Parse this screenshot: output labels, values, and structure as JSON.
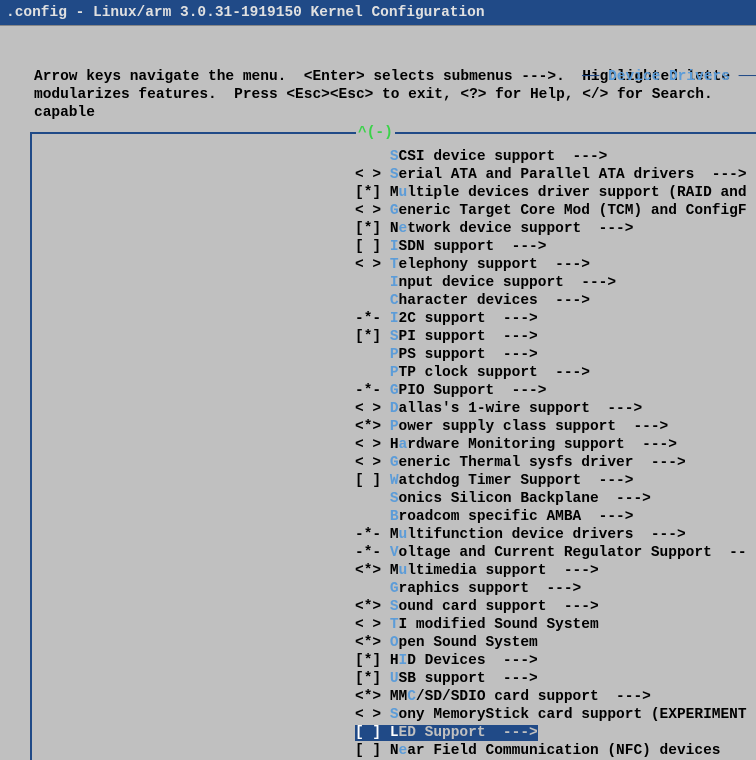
{
  "title": ".config - Linux/arm 3.0.31-1919150 Kernel Configuration",
  "section": "Device Drivers",
  "help": {
    "l1": "Arrow keys navigate the menu.  <Enter> selects submenus --->.  Highlighted lette",
    "l2": "modularizes features.  Press <Esc><Esc> to exit, <?> for Help, </> for Search.  ",
    "l3": "capable"
  },
  "scrollhint": "^(-)",
  "items": [
    {
      "pref": "    ",
      "hot": "S",
      "hotIdx": 0,
      "label": "CSI device support  --->"
    },
    {
      "pref": "< > ",
      "hot": "S",
      "hotIdx": 0,
      "label": "erial ATA and Parallel ATA drivers  --->"
    },
    {
      "pref": "[*] ",
      "hot": "u",
      "hotIdx": 1,
      "pre": "M",
      "label": "ltiple devices driver support (RAID and"
    },
    {
      "pref": "< > ",
      "hot": "G",
      "hotIdx": 0,
      "label": "eneric Target Core Mod (TCM) and ConfigF"
    },
    {
      "pref": "[*] ",
      "hot": "e",
      "hotIdx": 1,
      "pre": "N",
      "label": "twork device support  --->"
    },
    {
      "pref": "[ ] ",
      "hot": "I",
      "hotIdx": 0,
      "label": "SDN support  --->"
    },
    {
      "pref": "< > ",
      "hot": "T",
      "hotIdx": 0,
      "label": "elephony support  --->"
    },
    {
      "pref": "    ",
      "hot": "I",
      "hotIdx": 0,
      "label": "nput device support  --->"
    },
    {
      "pref": "    ",
      "hot": "C",
      "hotIdx": 0,
      "label": "haracter devices  --->"
    },
    {
      "pref": "-*- ",
      "hot": "I",
      "hotIdx": 0,
      "label": "2C support  --->"
    },
    {
      "pref": "[*] ",
      "hot": "S",
      "hotIdx": 0,
      "label": "PI support  --->"
    },
    {
      "pref": "    ",
      "hot": "P",
      "hotIdx": 0,
      "label": "PS support  --->"
    },
    {
      "pref": "    ",
      "hot": "P",
      "hotIdx": 0,
      "label": "TP clock support  --->"
    },
    {
      "pref": "-*- ",
      "hot": "G",
      "hotIdx": 0,
      "label": "PIO Support  --->"
    },
    {
      "pref": "< > ",
      "hot": "D",
      "hotIdx": 0,
      "label": "allas's 1-wire support  --->"
    },
    {
      "pref": "<*> ",
      "hot": "P",
      "hotIdx": 0,
      "label": "ower supply class support  --->"
    },
    {
      "pref": "< > ",
      "hot": "a",
      "hotIdx": 1,
      "pre": "H",
      "label": "rdware Monitoring support  --->"
    },
    {
      "pref": "< > ",
      "hot": "G",
      "hotIdx": 0,
      "label": "eneric Thermal sysfs driver  --->"
    },
    {
      "pref": "[ ] ",
      "hot": "W",
      "hotIdx": 0,
      "label": "atchdog Timer Support  --->"
    },
    {
      "pref": "    ",
      "hot": "S",
      "hotIdx": 0,
      "label": "onics Silicon Backplane  --->"
    },
    {
      "pref": "    ",
      "hot": "B",
      "hotIdx": 0,
      "label": "roadcom specific AMBA  --->"
    },
    {
      "pref": "-*- ",
      "hot": "u",
      "hotIdx": 1,
      "pre": "M",
      "label": "ltifunction device drivers  --->"
    },
    {
      "pref": "-*- ",
      "hot": "V",
      "hotIdx": 0,
      "label": "oltage and Current Regulator Support  --"
    },
    {
      "pref": "<*> ",
      "hot": "u",
      "hotIdx": 1,
      "pre": "M",
      "label": "ltimedia support  --->"
    },
    {
      "pref": "    ",
      "hot": "G",
      "hotIdx": 0,
      "label": "raphics support  --->"
    },
    {
      "pref": "<*> ",
      "hot": "S",
      "hotIdx": 0,
      "label": "ound card support  --->"
    },
    {
      "pref": "< > ",
      "hot": "T",
      "hotIdx": 0,
      "label": "I modified Sound System"
    },
    {
      "pref": "<*> ",
      "hot": "O",
      "hotIdx": 0,
      "label": "pen Sound System"
    },
    {
      "pref": "[*] ",
      "hot": "I",
      "hotIdx": 1,
      "pre": "H",
      "label": "D Devices  --->"
    },
    {
      "pref": "[*] ",
      "hot": "U",
      "hotIdx": 0,
      "label": "SB support  --->"
    },
    {
      "pref": "<*> ",
      "hot": "C",
      "hotIdx": 2,
      "pre": "MM",
      "label": "/SD/SDIO card support  --->"
    },
    {
      "pref": "< > ",
      "hot": "S",
      "hotIdx": 0,
      "label": "ony MemoryStick card support (EXPERIMENT"
    },
    {
      "pref": "[ ] ",
      "hot": "L",
      "hotIdx": 0,
      "label": "ED Support  --->",
      "selected": true
    },
    {
      "pref": "[ ] ",
      "hot": "e",
      "hotIdx": 1,
      "pre": "N",
      "label": "ar Field Communication (NFC) devices"
    }
  ]
}
